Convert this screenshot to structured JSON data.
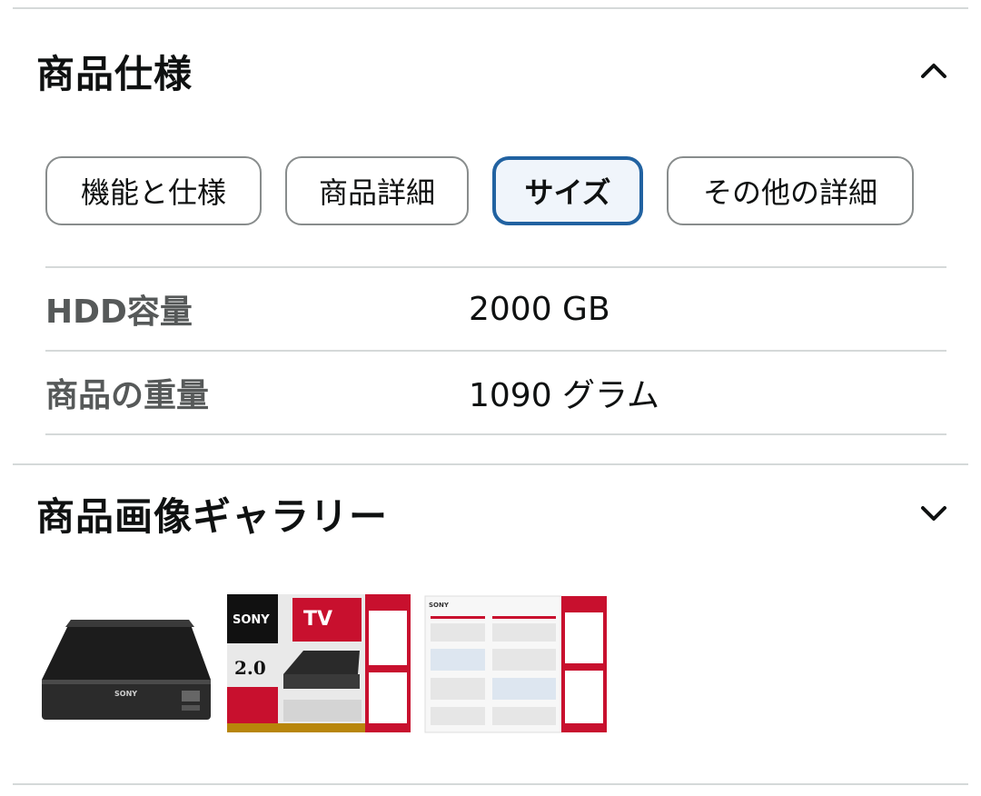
{
  "spec_section": {
    "title": "商品仕様",
    "expanded": true,
    "toggle_icon": "chevron-up-icon"
  },
  "tabs": [
    {
      "label": "機能と仕様",
      "active": false
    },
    {
      "label": "商品詳細",
      "active": false
    },
    {
      "label": "サイズ",
      "active": true
    },
    {
      "label": "その他の詳細",
      "active": false
    }
  ],
  "specs": [
    {
      "key": "HDD容量",
      "value": "2000 GB"
    },
    {
      "key": "商品の重量",
      "value": "1090 グラム"
    }
  ],
  "gallery_section": {
    "title": "商品画像ギャラリー",
    "expanded": false,
    "toggle_icon": "chevron-down-icon"
  },
  "gallery": {
    "thumbnails": [
      {
        "name": "hdd-front-image",
        "brand": "SONY"
      },
      {
        "name": "package-box-image",
        "brand": "SONY",
        "badge": "TV",
        "capacity": "2.0"
      },
      {
        "name": "manual-leaflet-image",
        "brand": "SONY"
      }
    ]
  },
  "colors": {
    "accent_border": "#2162a1",
    "active_tab_bg": "#f0f5fb",
    "divider": "#d5d9d9",
    "key_text": "#565959",
    "sony_red": "#c8102e"
  }
}
